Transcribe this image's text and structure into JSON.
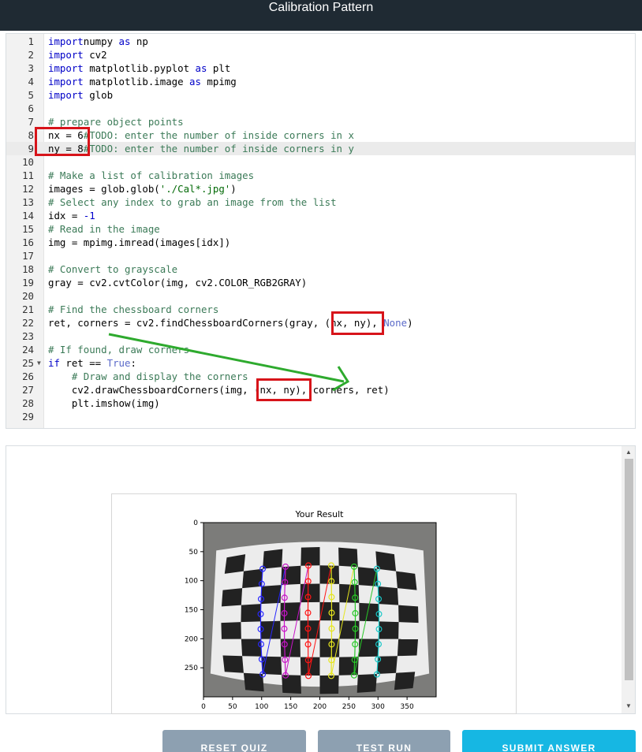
{
  "window": {
    "title": "Calibration Pattern"
  },
  "code_lines": [
    {
      "n": "1",
      "parts": [
        [
          "kw",
          "import"
        ],
        [
          "",
          "numpy "
        ],
        [
          "kw",
          "as"
        ],
        [
          "",
          " np"
        ]
      ]
    },
    {
      "n": "2",
      "parts": [
        [
          "kw",
          "import"
        ],
        [
          "",
          " cv2"
        ]
      ]
    },
    {
      "n": "3",
      "parts": [
        [
          "kw",
          "import"
        ],
        [
          "",
          " matplotlib.pyplot "
        ],
        [
          "kw",
          "as"
        ],
        [
          "",
          " plt"
        ]
      ]
    },
    {
      "n": "4",
      "parts": [
        [
          "kw",
          "import"
        ],
        [
          "",
          " matplotlib.image "
        ],
        [
          "kw",
          "as"
        ],
        [
          "",
          " mpimg"
        ]
      ]
    },
    {
      "n": "5",
      "parts": [
        [
          "kw",
          "import"
        ],
        [
          "",
          " glob"
        ]
      ]
    },
    {
      "n": "6",
      "parts": []
    },
    {
      "n": "7",
      "parts": [
        [
          "cm",
          "# prepare object points"
        ]
      ]
    },
    {
      "n": "8",
      "parts": [
        [
          "",
          "nx = 6"
        ],
        [
          "cm",
          "#TODO: enter the number of inside corners in x"
        ]
      ]
    },
    {
      "n": "9",
      "parts": [
        [
          "",
          "ny = 8"
        ],
        [
          "cm",
          "#TODO: enter the number of inside corners in y"
        ]
      ],
      "active": true
    },
    {
      "n": "10",
      "parts": []
    },
    {
      "n": "11",
      "parts": [
        [
          "cm",
          "# Make a list of calibration images"
        ]
      ]
    },
    {
      "n": "12",
      "parts": [
        [
          "",
          "images = glob.glob("
        ],
        [
          "st",
          "'./Cal*.jpg'"
        ],
        [
          "",
          ")"
        ]
      ]
    },
    {
      "n": "13",
      "parts": [
        [
          "cm",
          "# Select any index to grab an image from the list"
        ]
      ]
    },
    {
      "n": "14",
      "parts": [
        [
          "",
          "idx = "
        ],
        [
          "nm",
          "-1"
        ]
      ]
    },
    {
      "n": "15",
      "parts": [
        [
          "cm",
          "# Read in the image"
        ]
      ]
    },
    {
      "n": "16",
      "parts": [
        [
          "",
          "img = mpimg.imread(images[idx])"
        ]
      ]
    },
    {
      "n": "17",
      "parts": []
    },
    {
      "n": "18",
      "parts": [
        [
          "cm",
          "# Convert to grayscale"
        ]
      ]
    },
    {
      "n": "19",
      "parts": [
        [
          "",
          "gray = cv2.cvtColor(img, cv2.COLOR_RGB2GRAY)"
        ]
      ]
    },
    {
      "n": "20",
      "parts": []
    },
    {
      "n": "21",
      "parts": [
        [
          "cm",
          "# Find the chessboard corners"
        ]
      ]
    },
    {
      "n": "22",
      "parts": [
        [
          "",
          "ret, corners = cv2.findChessboardCorners(gray, (nx, ny), "
        ],
        [
          "bi",
          "None"
        ],
        [
          "",
          ")"
        ]
      ]
    },
    {
      "n": "23",
      "parts": []
    },
    {
      "n": "24",
      "parts": [
        [
          "cm",
          "# If found, draw corners"
        ]
      ]
    },
    {
      "n": "25",
      "parts": [
        [
          "kw",
          "if"
        ],
        [
          "",
          " ret == "
        ],
        [
          "bi",
          "True"
        ],
        [
          "",
          ":"
        ]
      ],
      "fold": true
    },
    {
      "n": "26",
      "parts": [
        [
          "",
          "    "
        ],
        [
          "cm",
          "# Draw and display the corners"
        ]
      ]
    },
    {
      "n": "27",
      "parts": [
        [
          "",
          "    cv2.drawChessboardCorners(img, (nx, ny), corners, ret)"
        ]
      ]
    },
    {
      "n": "28",
      "parts": [
        [
          "",
          "    plt.imshow(img)"
        ]
      ]
    },
    {
      "n": "29",
      "parts": []
    }
  ],
  "figure": {
    "title": "Your Result",
    "x_ticks": [
      "0",
      "50",
      "100",
      "150",
      "200",
      "250",
      "300",
      "350"
    ],
    "y_ticks": [
      "0",
      "50",
      "100",
      "150",
      "200",
      "250"
    ]
  },
  "buttons": {
    "reset": "RESET QUIZ",
    "test": "TEST RUN",
    "submit": "SUBMIT ANSWER"
  },
  "colors": {
    "header": "#1f2a33",
    "highlight": "#d7141a",
    "arrow": "#2eaa2e",
    "button_gray": "#8da0b1",
    "button_blue": "#16b7e3"
  }
}
